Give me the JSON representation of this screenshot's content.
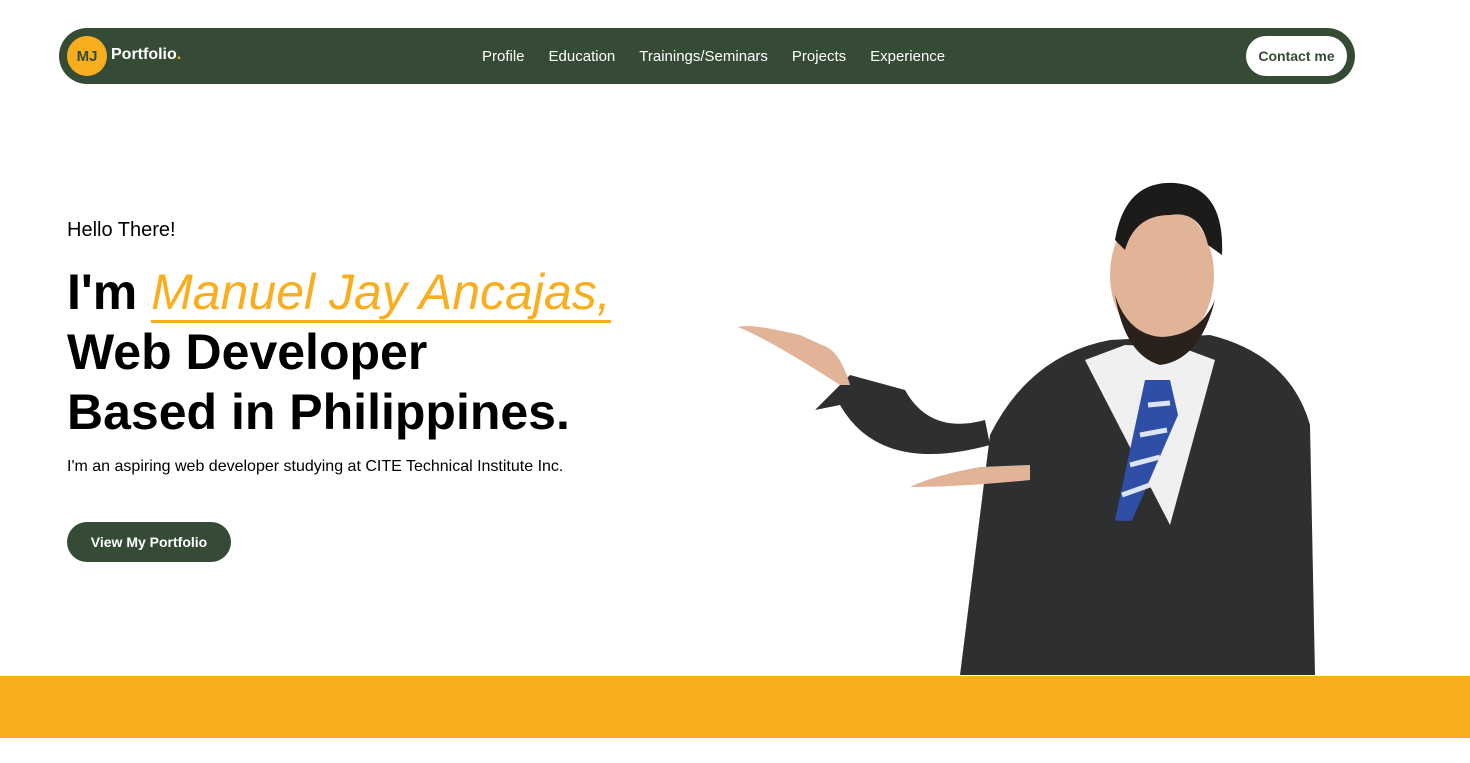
{
  "brand": {
    "initials": "MJ",
    "name": "Portfolio",
    "dot": "."
  },
  "nav": {
    "links": [
      "Profile",
      "Education",
      "Trainings/Seminars",
      "Projects",
      "Experience"
    ],
    "contact_label": "Contact me"
  },
  "hero": {
    "greeting": "Hello There!",
    "im": "I'm ",
    "name": "Manuel Jay Ancajas,",
    "line2": "Web Developer",
    "line3": "Based in Philippines.",
    "description": "I'm an aspiring web developer studying at CITE Technical Institute Inc.",
    "cta_label": "View My Portfolio"
  },
  "colors": {
    "primary_green": "#354b36",
    "accent_yellow": "#f8ae1f",
    "background": "#ffffff"
  },
  "icons": {
    "hero_image": "businessman-pointing-illustration"
  }
}
